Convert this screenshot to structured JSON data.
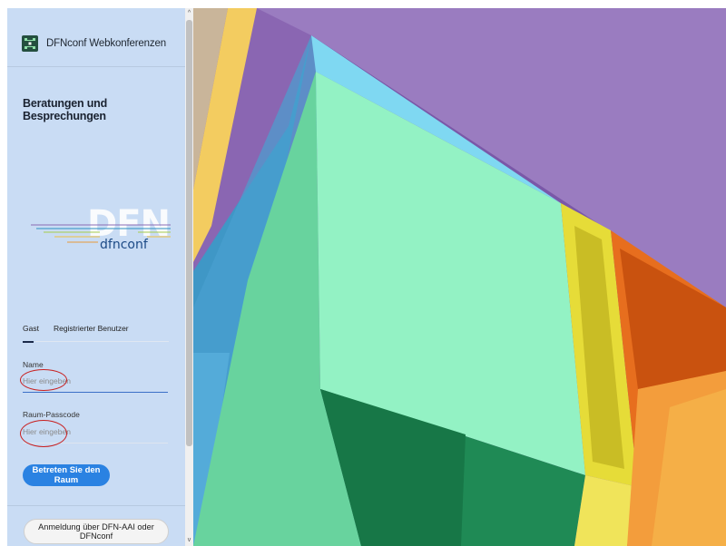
{
  "app": {
    "title": "DFNconf Webkonferenzen"
  },
  "page": {
    "title": "Beratungen und Besprechungen"
  },
  "logo": {
    "big_text": "DFN",
    "small_text": "dfnconf"
  },
  "tabs": [
    {
      "label": "Gast"
    },
    {
      "label": "Registrierter Benutzer"
    }
  ],
  "form": {
    "name_label": "Name",
    "name_placeholder": "Hier eingeben",
    "passcode_label": "Raum-Passcode",
    "passcode_placeholder": "Hier eingeben",
    "submit_label": "Betreten Sie den Raum"
  },
  "login": {
    "label": "Anmeldung über DFN-AAI oder DFNconf"
  },
  "scrollbar": {
    "up_glyph": "^",
    "down_glyph": "v"
  },
  "colors": {
    "panel_bg": "#c9dcf4",
    "accent": "#2a82e2",
    "annotation_red": "#c82020"
  }
}
